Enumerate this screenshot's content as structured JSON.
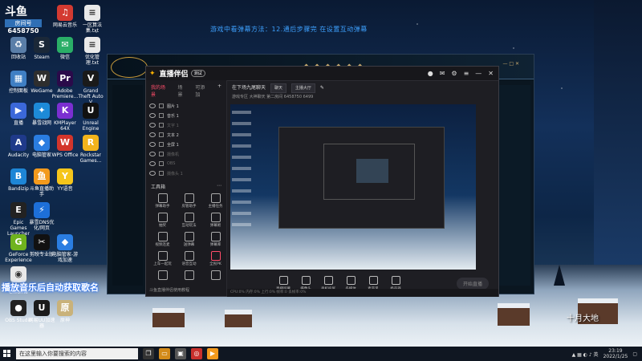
{
  "desktop": {
    "banner": "游戏中看弹幕方法：12.通后步骤完  在设置互动弹幕",
    "room": {
      "label": "房间号",
      "number": "6458750"
    },
    "overlay_text": "播放音乐后自动获取歌名",
    "calligraphy": "十月大地",
    "icons": [
      {
        "label": "回收站",
        "color": "#5a7ea8",
        "glyph": "♻"
      },
      {
        "label": "网易云音乐",
        "color": "#d33a31",
        "glyph": "♫"
      },
      {
        "label": "一区算法集.txt",
        "color": "#e9e9e9",
        "glyph": "≡"
      },
      {
        "label": "Steam",
        "color": "#1b2838",
        "glyph": "S"
      },
      {
        "label": "微信",
        "color": "#2aae67",
        "glyph": "✉"
      },
      {
        "label": "优化管理.txt",
        "color": "#e9e9e9",
        "glyph": "≡"
      },
      {
        "label": "控制面板",
        "color": "#3f7fc4",
        "glyph": "▦"
      },
      {
        "label": "WeGame",
        "color": "#2e2e2e",
        "glyph": "W"
      },
      {
        "label": "Adobe Premiere...",
        "color": "#2a0a4a",
        "glyph": "Pr"
      },
      {
        "label": "Grand Theft Auto V",
        "color": "#1a1a1a",
        "glyph": "V"
      },
      {
        "label": "直播",
        "color": "#3b68d9",
        "glyph": "▶"
      },
      {
        "label": "暴雪战网",
        "color": "#1d8ad8",
        "glyph": "✦"
      },
      {
        "label": "KMPlayer 64X",
        "color": "#7b2fd1",
        "glyph": "K"
      },
      {
        "label": "Unreal Engine",
        "color": "#111",
        "glyph": "U"
      },
      {
        "label": "Audacity",
        "color": "#1f3a8a",
        "glyph": "A"
      },
      {
        "label": "电脑管家",
        "color": "#2a7de1",
        "glyph": "◆"
      },
      {
        "label": "WPS Office",
        "color": "#d3352b",
        "glyph": "W"
      },
      {
        "label": "Rockstar Games...",
        "color": "#f2b31b",
        "glyph": "R"
      },
      {
        "label": "Bandizip",
        "color": "#1e86d6",
        "glyph": "B"
      },
      {
        "label": "斗鱼直播助手",
        "color": "#f39a1d",
        "glyph": "鱼"
      },
      {
        "label": "YY语音",
        "color": "#f5c51b",
        "glyph": "Y"
      },
      {
        "label": "Epic Games Launcher",
        "color": "#222",
        "glyph": "E"
      },
      {
        "label": "暴雪DNS优化/网页",
        "color": "#1d6fd8",
        "glyph": "⚡"
      },
      {
        "label": "GeForce Experience",
        "color": "#6fb31e",
        "glyph": "G"
      },
      {
        "label": "剪映专业版",
        "color": "#111",
        "glyph": "✂"
      },
      {
        "label": "电脑管家-游戏加速",
        "color": "#2a7de1",
        "glyph": "◆"
      },
      {
        "label": "Google Chrome",
        "color": "#e9e9e9",
        "glyph": "◉"
      },
      {
        "label": "OBS Studio",
        "color": "#222",
        "glyph": "●"
      },
      {
        "label": "网易UU加速器",
        "color": "#1b1b1b",
        "glyph": "U"
      },
      {
        "label": "原神",
        "color": "#c9b27a",
        "glyph": "原"
      }
    ]
  },
  "taskbar": {
    "search_placeholder": "在这里输入你要搜索的内容",
    "time": "23:19",
    "date": "2022/1/25"
  },
  "app": {
    "title": "直播伴侣",
    "badge": "测试",
    "sidebar_tabs": [
      "我的场景",
      "场景",
      "可添加"
    ],
    "scenes": [
      {
        "name": "图片 1",
        "dim": false
      },
      {
        "name": "音乐 1",
        "dim": false
      },
      {
        "name": "文字 1",
        "dim": true
      },
      {
        "name": "文本 2",
        "dim": false
      },
      {
        "name": "全屏 1",
        "dim": false
      },
      {
        "name": "摄像机",
        "dim": true
      },
      {
        "name": "OBS",
        "dim": true
      },
      {
        "name": "摄像头 1",
        "dim": true
      }
    ],
    "tools_title": "工具箱",
    "tools": [
      {
        "label": "弹幕助手",
        "red": false
      },
      {
        "label": "房管助手",
        "red": false
      },
      {
        "label": "主播任务",
        "red": false
      },
      {
        "label": "抽奖",
        "red": false
      },
      {
        "label": "互动玩法",
        "red": false
      },
      {
        "label": "弹幕姬",
        "red": false
      },
      {
        "label": "视频连麦",
        "red": false
      },
      {
        "label": "送弹幕",
        "red": false
      },
      {
        "label": "弹幕库",
        "red": false
      },
      {
        "label": "上车一起玩",
        "red": false
      },
      {
        "label": "语音互动",
        "red": false
      },
      {
        "label": "全民PK",
        "red": true
      },
      {
        "label": "",
        "red": false
      },
      {
        "label": "",
        "red": false
      },
      {
        "label": "",
        "red": false
      }
    ],
    "sidebar_footer": "斗鱼直播伴侣使用教程",
    "info": {
      "title": "在下场九尾聊天",
      "chip1": "聊天",
      "chip2": "主播大厅",
      "line2": "游戏专区  大神聊天   第二房间   6458750   6499"
    },
    "controls": [
      "直播屏幕",
      "摄像头",
      "手机投屏",
      "多媒体",
      "麦克风",
      "扬声器"
    ],
    "start_live": "开始直播",
    "status": "  CPU:0%   内存:0%   上行:0%   帧率:0   丢帧率:0%"
  }
}
